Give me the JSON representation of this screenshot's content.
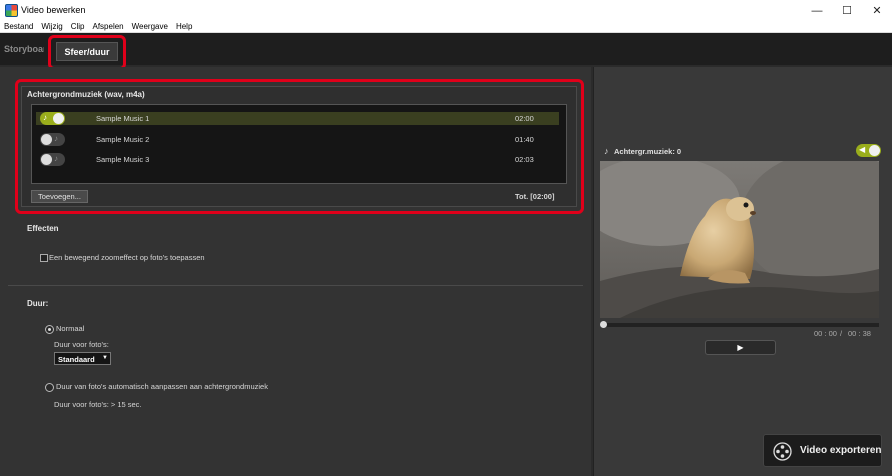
{
  "window": {
    "title": "Video bewerken",
    "minimize": "—",
    "maximize": "☐",
    "close": "✕"
  },
  "menu": [
    "Bestand",
    "Wijzig",
    "Clip",
    "Afspelen",
    "Weergave",
    "Help"
  ],
  "tabs": {
    "storyboard": "Storyboard",
    "active": "Sfeer/duur"
  },
  "music": {
    "title": "Achtergrondmuziek (wav, m4a)",
    "tracks": [
      {
        "name": "Sample Music 1",
        "duration": "02:00",
        "enabled": true
      },
      {
        "name": "Sample Music 2",
        "duration": "01:40",
        "enabled": false
      },
      {
        "name": "Sample Music 3",
        "duration": "02:03",
        "enabled": false
      }
    ],
    "add_button": "Toevoegen...",
    "total": "Tot. [02:00]"
  },
  "effects": {
    "title": "Effecten",
    "zoom_checkbox_label": "Een bewegend zoomeffect op foto's toepassen",
    "zoom_checked": false
  },
  "duration": {
    "title": "Duur:",
    "normal_label": "Normaal",
    "normal_selected": true,
    "photo_duration_label": "Duur voor foto's:",
    "photo_duration_value": "Standaard",
    "auto_label": "Duur van foto's automatisch aanpassen aan achtergrondmuziek",
    "auto_note": "Duur voor foto's: > 15 sec."
  },
  "preview": {
    "music_label": "Achtergr.muziek: 0",
    "time_current": "00 : 00",
    "time_separator": "/",
    "time_total": "00 : 38",
    "playback_progress": 0,
    "play_icon": "▶"
  },
  "export_button": "Video exporteren",
  "colors": {
    "accent": "#9aae1c",
    "highlight": "#e0001a"
  }
}
